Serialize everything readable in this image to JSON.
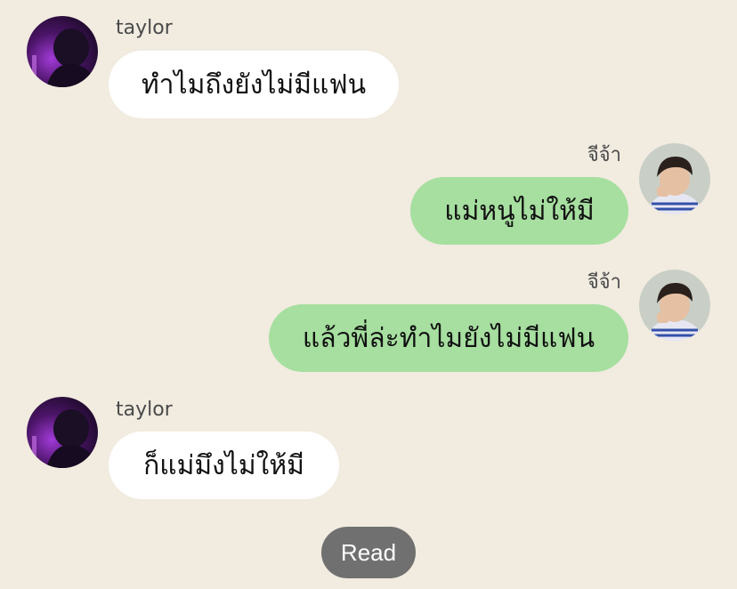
{
  "messages": [
    {
      "sender": "taylor",
      "text": "ทำไมถึงยังไม่มีแฟน",
      "side": "incoming",
      "avatar": "taylor-avatar"
    },
    {
      "sender": "จีจ้า",
      "text": "แม่หนูไม่ให้มี",
      "side": "outgoing",
      "avatar": "jija-avatar"
    },
    {
      "sender": "จีจ้า",
      "text": "แล้วพี่ล่ะทำไมยังไม่มีแฟน",
      "side": "outgoing",
      "avatar": "jija-avatar"
    },
    {
      "sender": "taylor",
      "text": "ก็แม่มึงไม่ให้มี",
      "side": "incoming",
      "avatar": "taylor-avatar"
    }
  ],
  "status": {
    "label": "Read"
  },
  "colors": {
    "background": "#f1ebe0",
    "incoming_bubble": "#ffffff",
    "outgoing_bubble": "#a6df9f",
    "read_badge": "#707070"
  }
}
